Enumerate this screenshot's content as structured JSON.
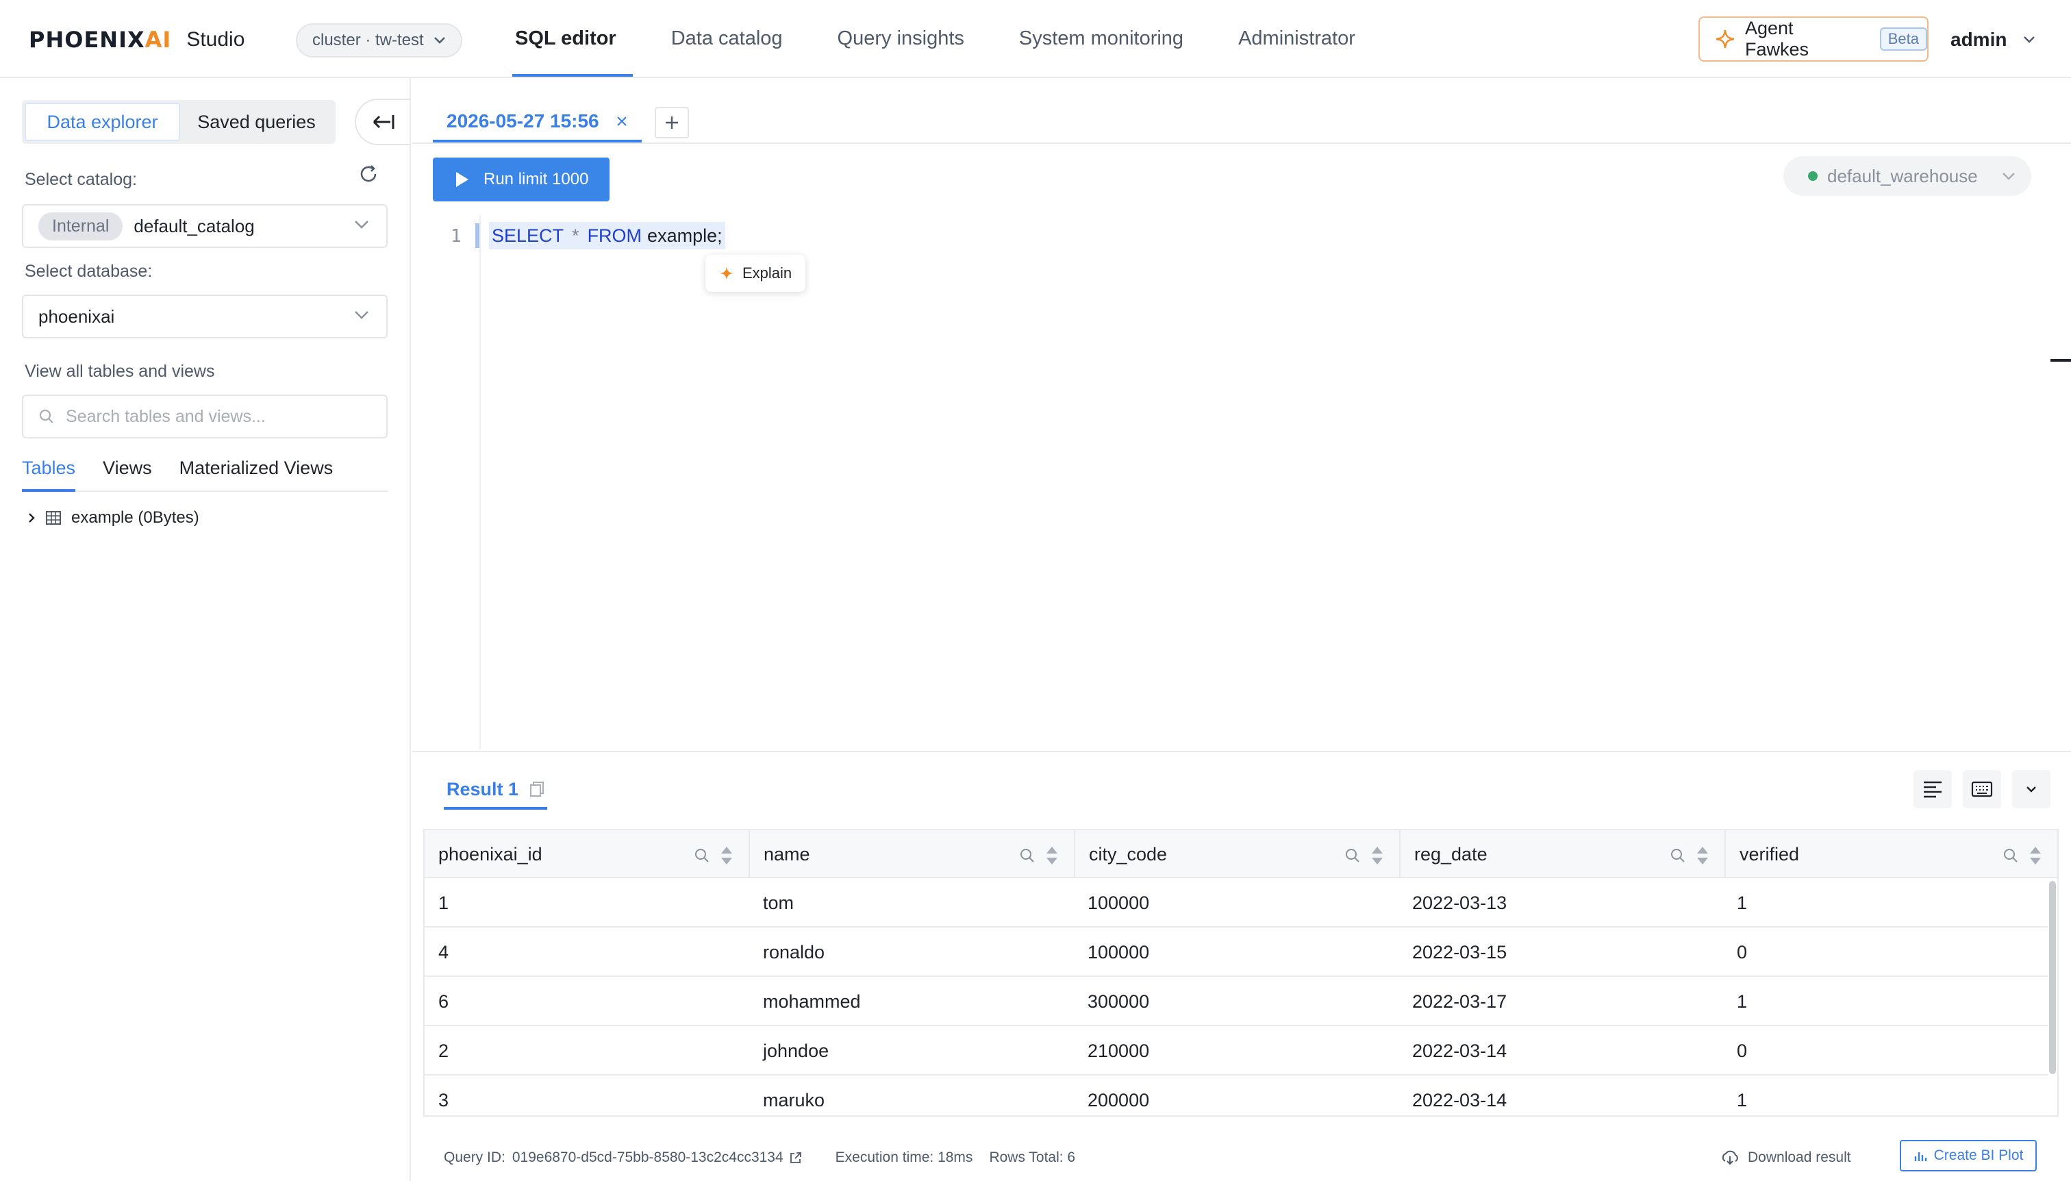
{
  "header": {
    "logo_text_main": "PHOENIX",
    "logo_text_ai": "AI",
    "product": "Studio",
    "cluster": "cluster · tw-test",
    "nav": [
      {
        "label": "SQL editor",
        "active": true
      },
      {
        "label": "Data catalog",
        "active": false
      },
      {
        "label": "Query insights",
        "active": false
      },
      {
        "label": "System monitoring",
        "active": false
      },
      {
        "label": "Administrator",
        "active": false
      }
    ],
    "agent_label": "Agent Fawkes",
    "agent_badge": "Beta",
    "user": "admin"
  },
  "sidebar": {
    "seg_data_explorer": "Data explorer",
    "seg_saved_queries": "Saved queries",
    "select_catalog_label": "Select catalog:",
    "catalog_tag": "Internal",
    "catalog_value": "default_catalog",
    "select_database_label": "Select database:",
    "database_value": "phoenixai",
    "view_all_label": "View all tables and views",
    "search_placeholder": "Search tables and views...",
    "tabs": [
      "Tables",
      "Views",
      "Materialized Views"
    ],
    "tree_item": "example (0Bytes)"
  },
  "editor": {
    "tab_label": "2026-05-27 15:56",
    "run_label": "Run limit 1000",
    "warehouse": "default_warehouse",
    "line_number": "1",
    "sql": {
      "kw1": "SELECT",
      "star": "*",
      "kw2": "FROM",
      "table": "example;"
    },
    "explain": "Explain"
  },
  "results": {
    "tab_label": "Result 1",
    "columns": [
      "phoenixai_id",
      "name",
      "city_code",
      "reg_date",
      "verified"
    ],
    "rows": [
      [
        "1",
        "tom",
        "100000",
        "2022-03-13",
        "1"
      ],
      [
        "4",
        "ronaldo",
        "100000",
        "2022-03-15",
        "0"
      ],
      [
        "6",
        "mohammed",
        "300000",
        "2022-03-17",
        "1"
      ],
      [
        "2",
        "johndoe",
        "210000",
        "2022-03-14",
        "0"
      ],
      [
        "3",
        "maruko",
        "200000",
        "2022-03-14",
        "1"
      ]
    ],
    "query_id_label": "Query ID:",
    "query_id": "019e6870-d5cd-75bb-8580-13c2c4cc3134",
    "execution_time": "Execution time: 18ms",
    "rows_total": "Rows Total: 6",
    "download": "Download result",
    "create_bi": "Create BI Plot"
  },
  "colors": {
    "accent": "#3a7fe6",
    "brand_orange": "#f08a24",
    "run_button": "#3a86e8",
    "status_ok": "#3aa76d"
  }
}
